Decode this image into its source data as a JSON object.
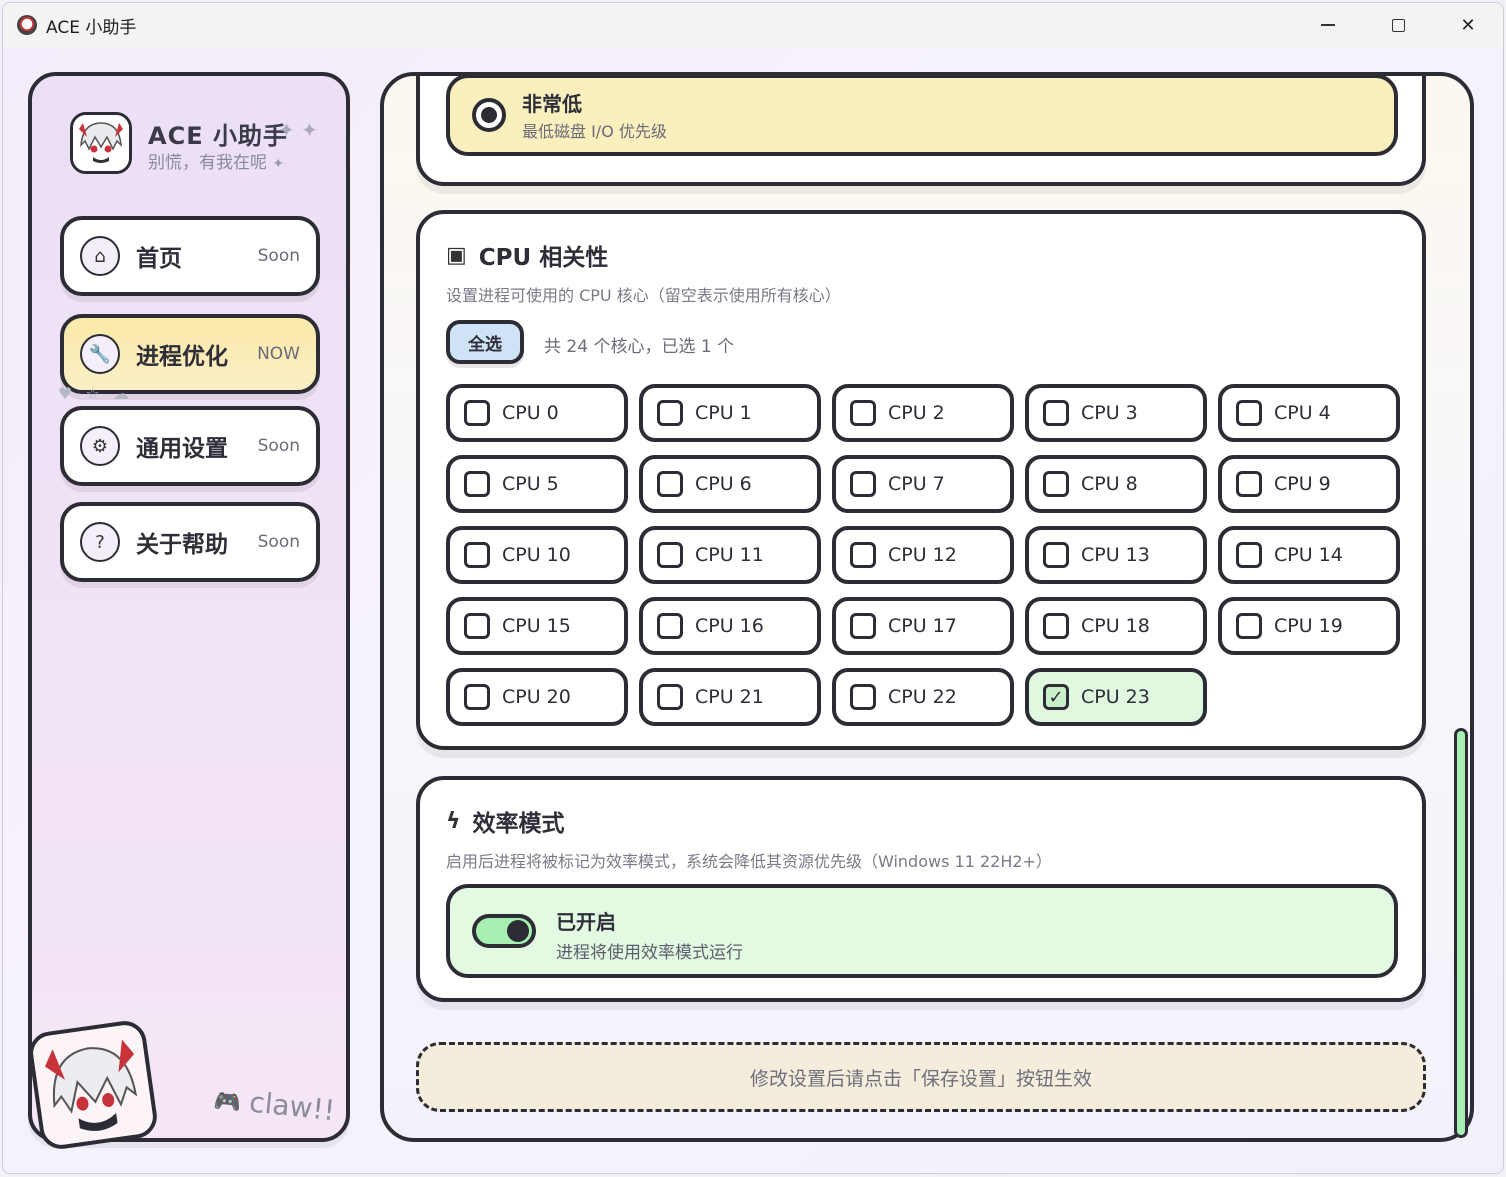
{
  "window": {
    "title": "ACE 小助手",
    "controls": {
      "minimize": "minimize-icon",
      "maximize": "maximize-icon",
      "close": "✕"
    }
  },
  "sidebar": {
    "brand_title": "ACE 小助手",
    "brand_sparkle": "✦ ✦",
    "brand_subtitle": "别慌，有我在呢",
    "brand_subtitle_sparkle": "✦",
    "items": [
      {
        "label": "首页",
        "badge": "Soon",
        "icon": "home-icon",
        "glyph": "⌂"
      },
      {
        "label": "进程优化",
        "badge": "NOW",
        "icon": "wrench-icon",
        "glyph": "🔧",
        "active": true
      },
      {
        "label": "通用设置",
        "badge": "Soon",
        "icon": "gear-icon",
        "glyph": "⚙"
      },
      {
        "label": "关于帮助",
        "badge": "Soon",
        "icon": "help-icon",
        "glyph": "?"
      }
    ],
    "decor": "♥ ☆ ☁",
    "footer_text": "claw!!",
    "footer_icon": "🎮"
  },
  "main": {
    "io": {
      "option_label": "非常低",
      "option_desc": "最低磁盘 I/O 优先级"
    },
    "cpu": {
      "title": "CPU 相关性",
      "title_icon": "▣",
      "description": "设置进程可使用的 CPU 核心（留空表示使用所有核心）",
      "select_all": "全选",
      "count_text": "共 24 个核心，已选 1 个",
      "cores": [
        {
          "label": "CPU 0",
          "checked": false
        },
        {
          "label": "CPU 1",
          "checked": false
        },
        {
          "label": "CPU 2",
          "checked": false
        },
        {
          "label": "CPU 3",
          "checked": false
        },
        {
          "label": "CPU 4",
          "checked": false
        },
        {
          "label": "CPU 5",
          "checked": false
        },
        {
          "label": "CPU 6",
          "checked": false
        },
        {
          "label": "CPU 7",
          "checked": false
        },
        {
          "label": "CPU 8",
          "checked": false
        },
        {
          "label": "CPU 9",
          "checked": false
        },
        {
          "label": "CPU 10",
          "checked": false
        },
        {
          "label": "CPU 11",
          "checked": false
        },
        {
          "label": "CPU 12",
          "checked": false
        },
        {
          "label": "CPU 13",
          "checked": false
        },
        {
          "label": "CPU 14",
          "checked": false
        },
        {
          "label": "CPU 15",
          "checked": false
        },
        {
          "label": "CPU 16",
          "checked": false
        },
        {
          "label": "CPU 17",
          "checked": false
        },
        {
          "label": "CPU 18",
          "checked": false
        },
        {
          "label": "CPU 19",
          "checked": false
        },
        {
          "label": "CPU 20",
          "checked": false
        },
        {
          "label": "CPU 21",
          "checked": false
        },
        {
          "label": "CPU 22",
          "checked": false
        },
        {
          "label": "CPU 23",
          "checked": true
        }
      ]
    },
    "efficiency": {
      "title": "效率模式",
      "title_icon": "ϟ",
      "description": "启用后进程将被标记为效率模式，系统会降低其资源优先级（Windows 11 22H2+）",
      "toggle_label": "已开启",
      "toggle_desc": "进程将使用效率模式运行",
      "enabled": true
    },
    "notice": "修改设置后请点击「保存设置」按钮生效"
  },
  "colors": {
    "outline": "#2c2c34",
    "active_nav": "#fbe9a8",
    "io_selected": "#fbf0bd",
    "checked_cell": "#dff8df",
    "toggle_on": "#a8efb2",
    "select_all": "#cfe3f7"
  }
}
